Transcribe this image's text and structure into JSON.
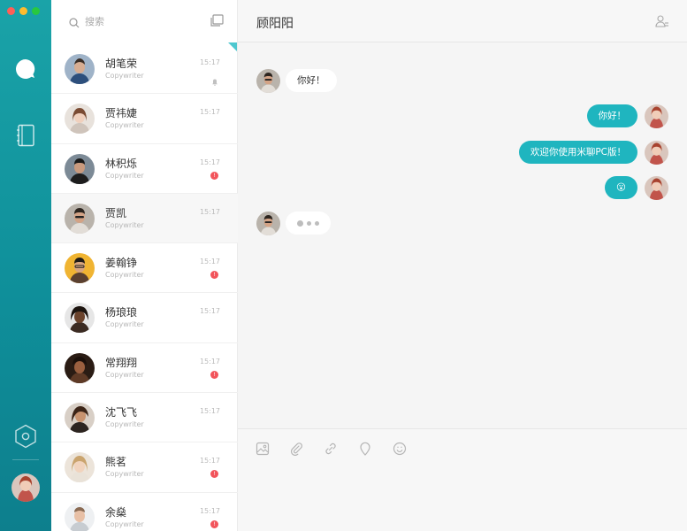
{
  "window": {
    "controls": [
      "close",
      "minimize",
      "maximize"
    ]
  },
  "rail": {
    "items": [
      {
        "icon": "chat-bubble-icon",
        "active": true
      },
      {
        "icon": "contacts-book-icon",
        "active": false
      },
      {
        "icon": "settings-hexagon-icon",
        "active": false
      }
    ]
  },
  "search": {
    "placeholder": "搜索",
    "icon": "search-icon",
    "compose_icon": "new-chat-icon"
  },
  "contacts": [
    {
      "name": "胡笔荣",
      "sub": "Copywriter",
      "time": "15:17",
      "status": "muted"
    },
    {
      "name": "贾祎婕",
      "sub": "Copywriter",
      "time": "15:17",
      "status": "none"
    },
    {
      "name": "林积烁",
      "sub": "Copywriter",
      "time": "15:17",
      "status": "unread"
    },
    {
      "name": "贾凯",
      "sub": "Copywriter",
      "time": "15:17",
      "status": "none",
      "active": true
    },
    {
      "name": "姜翰铮",
      "sub": "Copywriter",
      "time": "15:17",
      "status": "unread"
    },
    {
      "name": "杨琅琅",
      "sub": "Copywriter",
      "time": "15:17",
      "status": "none"
    },
    {
      "name": "常翔翔",
      "sub": "Copywriter",
      "time": "15:17",
      "status": "unread"
    },
    {
      "name": "沈飞飞",
      "sub": "Copywriter",
      "time": "15:17",
      "status": "none"
    },
    {
      "name": "熊茗",
      "sub": "Copywriter",
      "time": "15:17",
      "status": "unread"
    },
    {
      "name": "余燊",
      "sub": "Copywriter",
      "time": "15:17",
      "status": "unread"
    }
  ],
  "chat": {
    "title": "顾阳阳",
    "messages": [
      {
        "from": "them",
        "text": "你好！"
      },
      {
        "from": "me",
        "text": "你好！"
      },
      {
        "from": "me",
        "text": "欢迎你使用米聊PC版！"
      },
      {
        "from": "me",
        "text": "😮"
      },
      {
        "from": "them",
        "text": "",
        "typing": true
      }
    ],
    "toolbar": [
      "image-icon",
      "attachment-icon",
      "link-icon",
      "location-icon",
      "emoji-icon"
    ]
  },
  "colors": {
    "accent": "#1fb5bf",
    "rail_top": "#1aa3a8",
    "rail_bottom": "#0d7f8d",
    "badge": "#f2545b"
  }
}
